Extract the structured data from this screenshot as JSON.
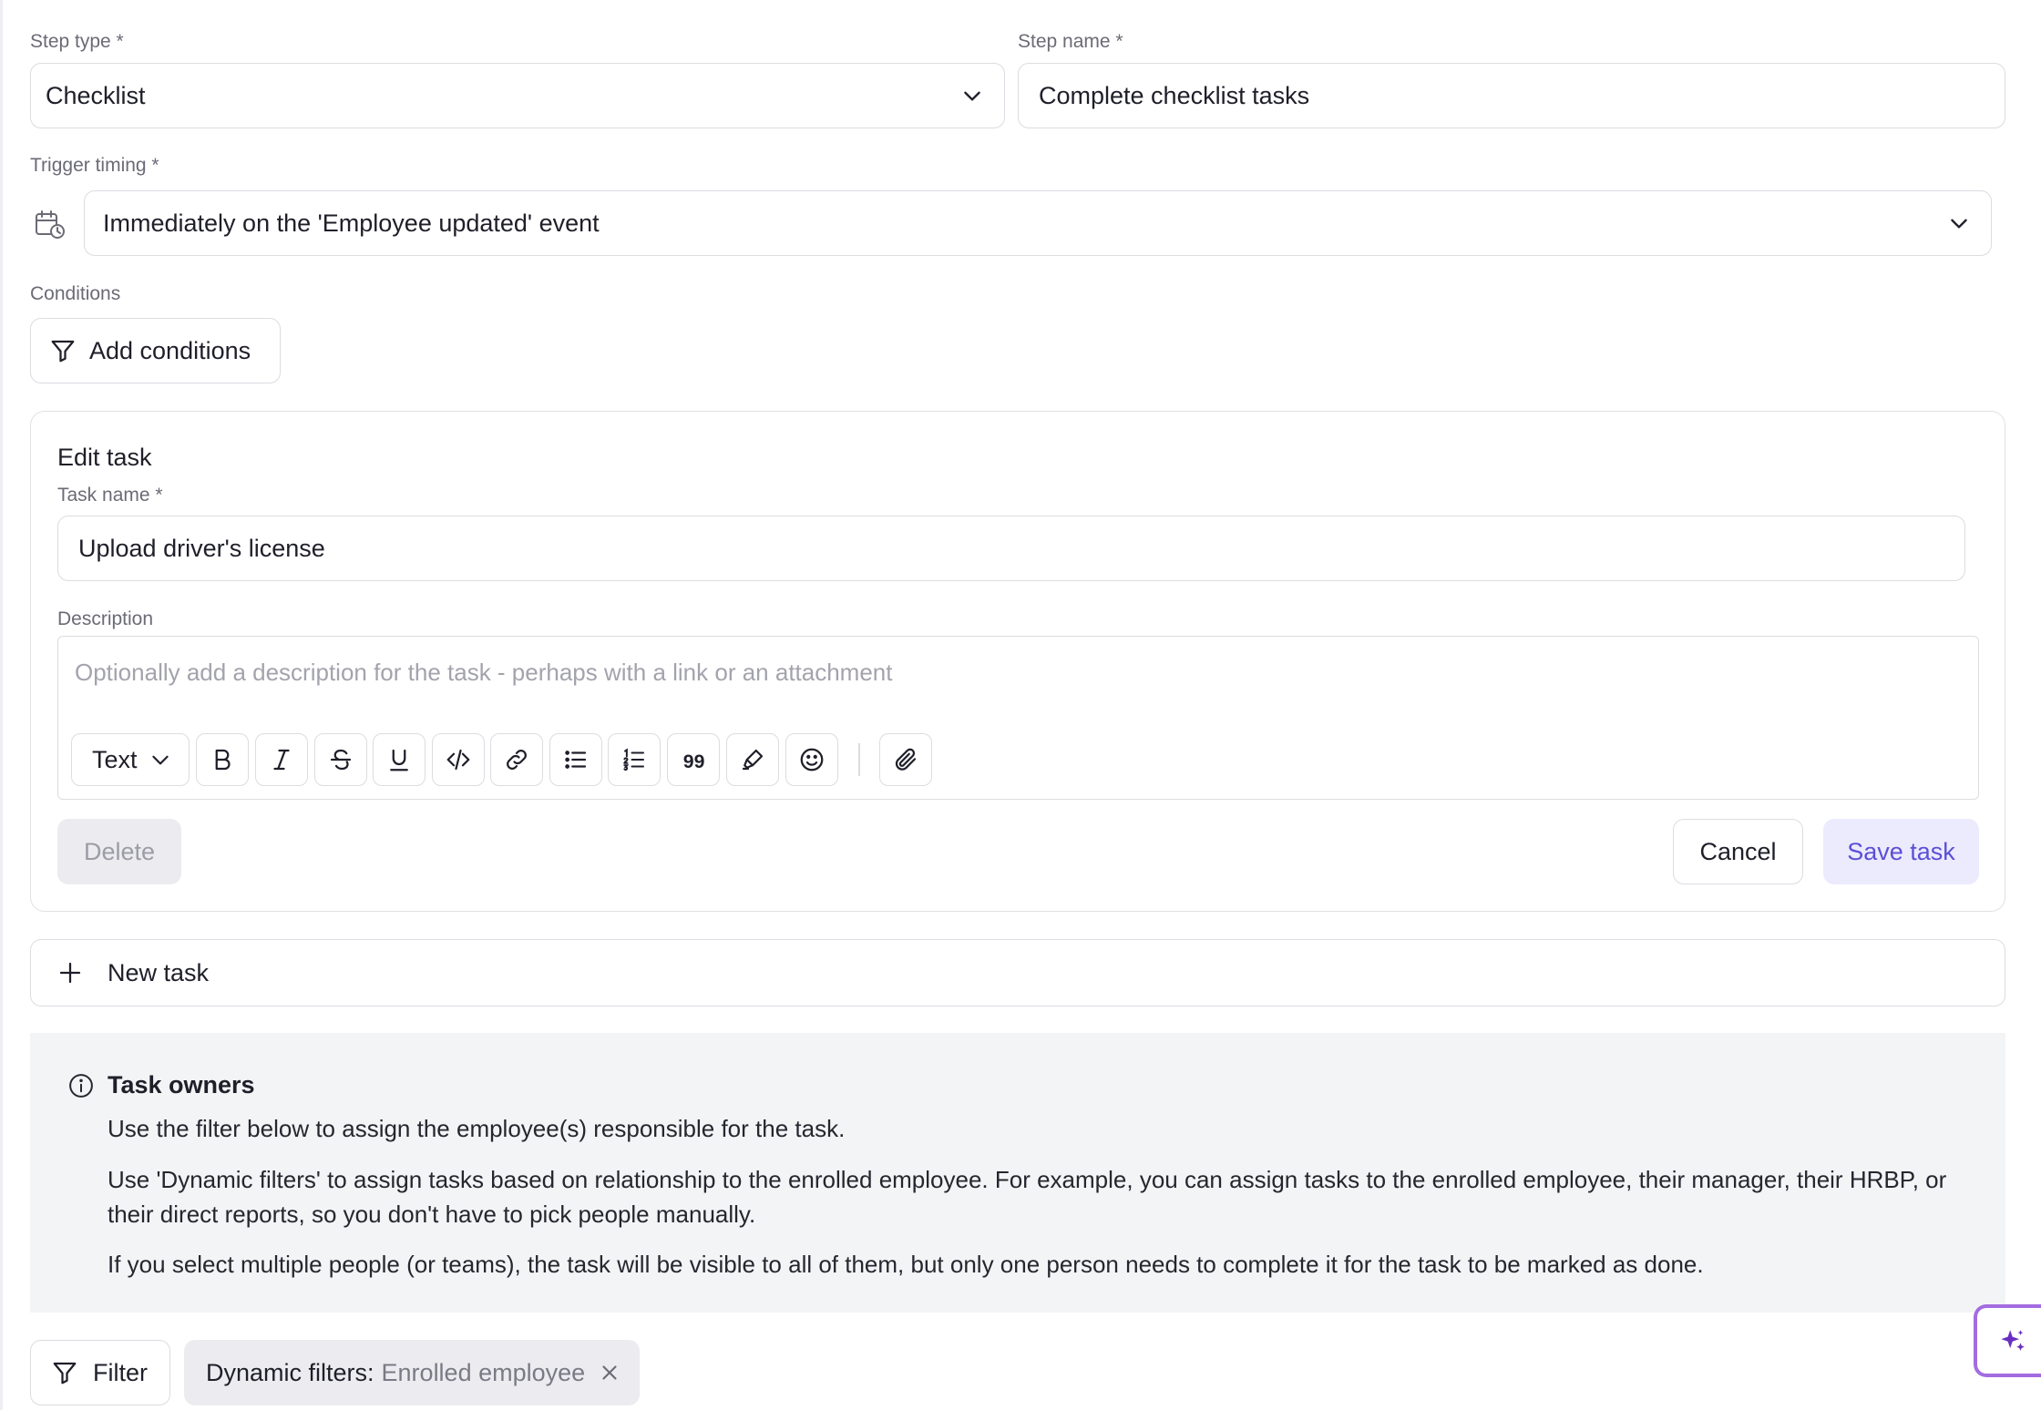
{
  "step_type": {
    "label": "Step type *",
    "value": "Checklist"
  },
  "step_name": {
    "label": "Step name *",
    "value": "Complete checklist tasks"
  },
  "trigger_timing": {
    "label": "Trigger timing *",
    "value": "Immediately on the 'Employee updated' event"
  },
  "conditions": {
    "label": "Conditions",
    "add_button": "Add conditions"
  },
  "edit_task": {
    "title": "Edit task",
    "task_name_label": "Task name *",
    "task_name_value": "Upload driver's license",
    "description_label": "Description",
    "description_placeholder": "Optionally add a description for the task - perhaps with a link or an attachment",
    "toolbar": {
      "text_style": "Text",
      "buttons": [
        "bold-icon",
        "italic-icon",
        "strikethrough-icon",
        "underline-icon",
        "code-icon",
        "link-icon",
        "bullet-list-icon",
        "numbered-list-icon",
        "quote-icon",
        "highlight-icon",
        "emoji-icon",
        "attachment-icon"
      ]
    },
    "delete_button": "Delete",
    "cancel_button": "Cancel",
    "save_button": "Save task"
  },
  "new_task_button": "New task",
  "task_owners": {
    "title": "Task owners",
    "paragraphs": [
      "Use the filter below to assign the employee(s) responsible for the task.",
      "Use 'Dynamic filters' to assign tasks based on relationship to the enrolled employee. For example, you can assign tasks to the enrolled employee, their manager, their HRBP, or their direct reports, so you don't have to pick people manually.",
      "If you select multiple people (or teams), the task will be visible to all of them, but only one person needs to complete it for the task to be marked as done."
    ]
  },
  "filter": {
    "button": "Filter",
    "chip_key": "Dynamic filters:",
    "chip_value": "Enrolled employee"
  },
  "ai_fab_icon": "sparkle-icon",
  "colors": {
    "accent": "#5b4fd6",
    "save_bg": "#ecebfd",
    "info_bg": "#f3f4f6",
    "delete_bg": "#ececf0"
  }
}
